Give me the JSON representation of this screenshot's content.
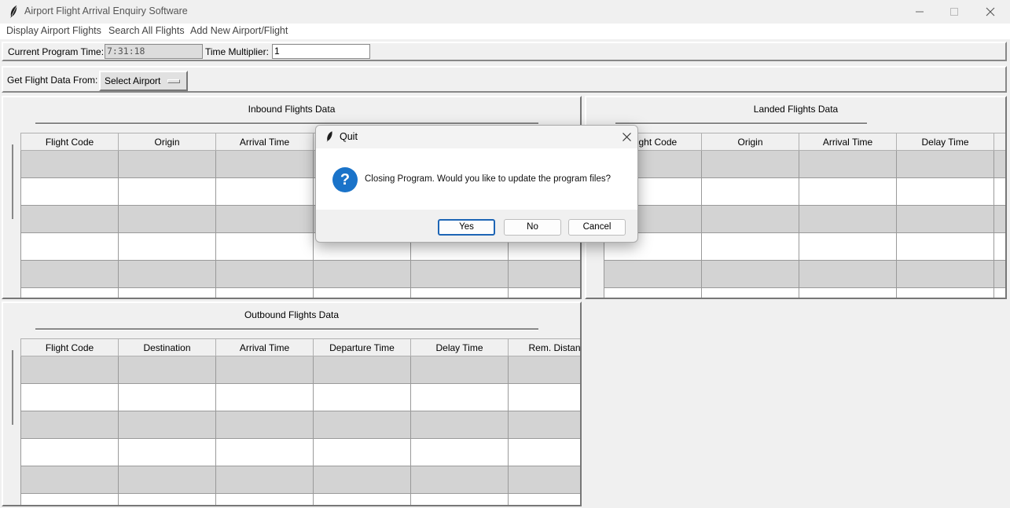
{
  "window": {
    "title": "Airport Flight Arrival Enquiry Software",
    "icon": "feather-icon"
  },
  "menu": [
    "Display Airport Flights",
    "Search All Flights",
    "Add New Airport/Flight"
  ],
  "toolbar": {
    "program_time_label": "Current Program Time:",
    "program_time_value": "7:31:18",
    "multiplier_label": "Time Multiplier:",
    "multiplier_value": "1",
    "get_from_label": "Get Flight Data From:",
    "select_airport_label": "Select Airport"
  },
  "inbound": {
    "title": "Inbound Flights Data",
    "columns": [
      "Flight Code",
      "Origin",
      "Arrival Time",
      "",
      "",
      ""
    ]
  },
  "landed": {
    "title": "Landed Flights Data",
    "columns": [
      "Flight Code",
      "Origin",
      "Arrival Time",
      "Delay Time",
      ""
    ]
  },
  "outbound": {
    "title": "Outbound Flights Data",
    "columns": [
      "Flight Code",
      "Destination",
      "Arrival Time",
      "Departure Time",
      "Delay Time",
      "Rem. Distanc"
    ]
  },
  "dialog": {
    "title": "Quit",
    "message": "Closing Program. Would you like to update the program files?",
    "buttons": {
      "yes": "Yes",
      "no": "No",
      "cancel": "Cancel"
    }
  },
  "colors": {
    "row_alt": "#d3d3d3",
    "row": "#ffffff",
    "dialog_accent": "#1a73c9"
  }
}
